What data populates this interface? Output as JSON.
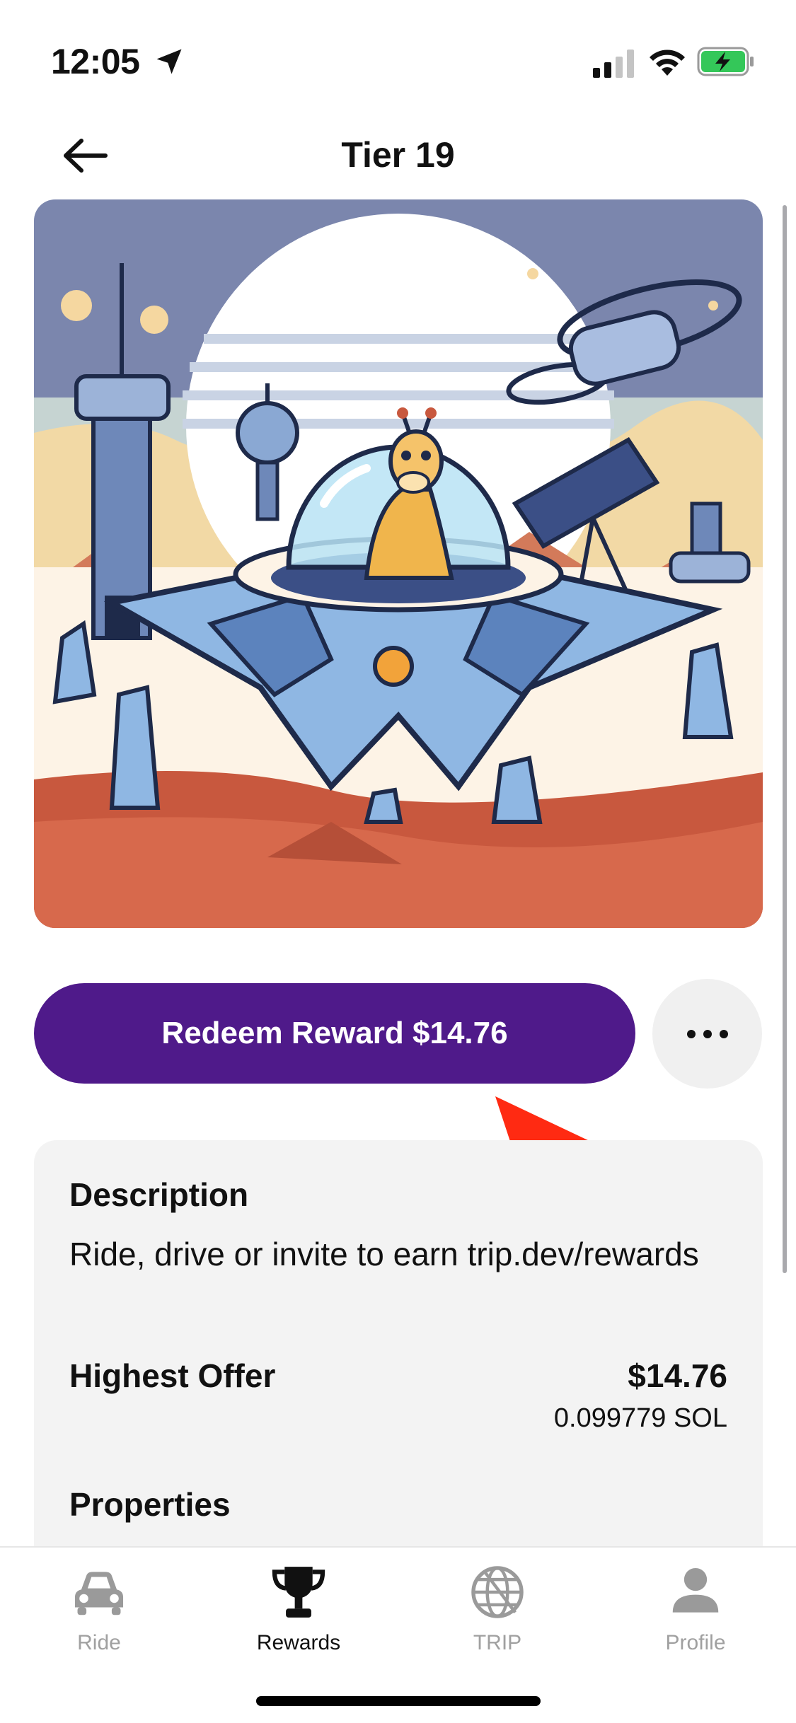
{
  "status_bar": {
    "time": "12:05"
  },
  "header": {
    "title": "Tier 19"
  },
  "actions": {
    "redeem_label": "Redeem Reward $14.76",
    "more_label": "•••"
  },
  "details": {
    "description_title": "Description",
    "description_text": "Ride, drive or invite to earn trip.dev/rewards",
    "offer_title": "Highest Offer",
    "offer_usd": "$14.76",
    "offer_sol": "0.099779 SOL",
    "properties_title": "Properties"
  },
  "tabs": [
    {
      "label": "Ride",
      "icon": "car-icon",
      "active": false
    },
    {
      "label": "Rewards",
      "icon": "trophy-icon",
      "active": true
    },
    {
      "label": "TRIP",
      "icon": "globe-icon",
      "active": false
    },
    {
      "label": "Profile",
      "icon": "person-icon",
      "active": false
    }
  ],
  "colors": {
    "accent": "#4f1a8a",
    "annotation": "#ff2a12",
    "card_bg": "#f3f3f3"
  },
  "hero_image": "illustration-giraffe-spaceship-desert"
}
